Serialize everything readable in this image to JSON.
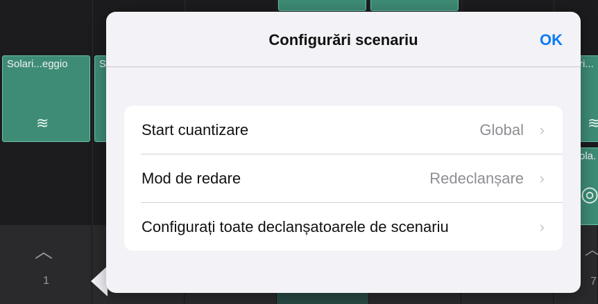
{
  "popover": {
    "title": "Configurări scenariu",
    "ok_label": "OK",
    "rows": [
      {
        "label": "Start cuantizare",
        "value": "Global"
      },
      {
        "label": "Mod de redare",
        "value": "Redeclanșare"
      },
      {
        "label": "Configurați toate declanșatoarele de scenariu",
        "value": ""
      }
    ],
    "chevron": "›"
  },
  "background": {
    "cells": [
      {
        "label": "Solari...eggio"
      },
      {
        "label": "S"
      },
      {
        "label": "ri..."
      },
      {
        "label": "ola."
      }
    ],
    "scene_numbers": [
      "1",
      "7"
    ],
    "up_chevron": "︿"
  },
  "colors": {
    "accent": "#0a7bf6",
    "cell_fill": "#3e8c76",
    "cell_border": "#6fc7ad"
  }
}
